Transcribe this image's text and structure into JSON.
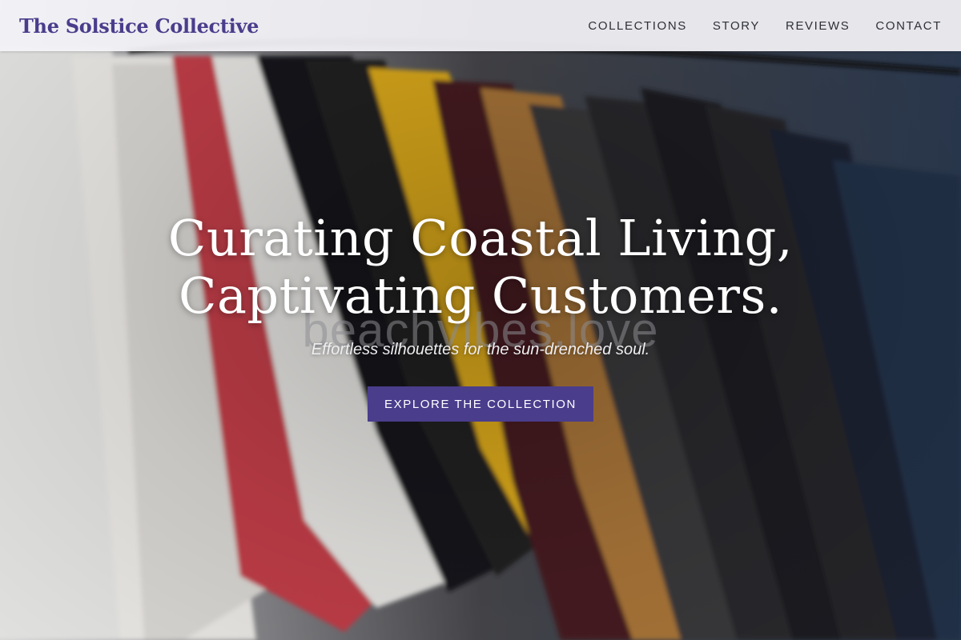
{
  "header": {
    "brand": "The Solstice Collective",
    "nav": [
      {
        "label": "COLLECTIONS"
      },
      {
        "label": "STORY"
      },
      {
        "label": "REVIEWS"
      },
      {
        "label": "CONTACT"
      }
    ]
  },
  "hero": {
    "title_line1": "Curating Coastal Living,",
    "title_line2": "Captivating Customers.",
    "watermark": "beachvibes.love",
    "tagline": "Effortless silhouettes for the sun-drenched soul.",
    "cta_label": "EXPLORE THE COLLECTION",
    "background_image": "clothing-rack-tshirts-photo"
  },
  "colors": {
    "brand": "#4a3d8c",
    "header_bg": "#f4f3f8",
    "nav_text": "#2f2f38",
    "hero_text": "#ffffff"
  }
}
